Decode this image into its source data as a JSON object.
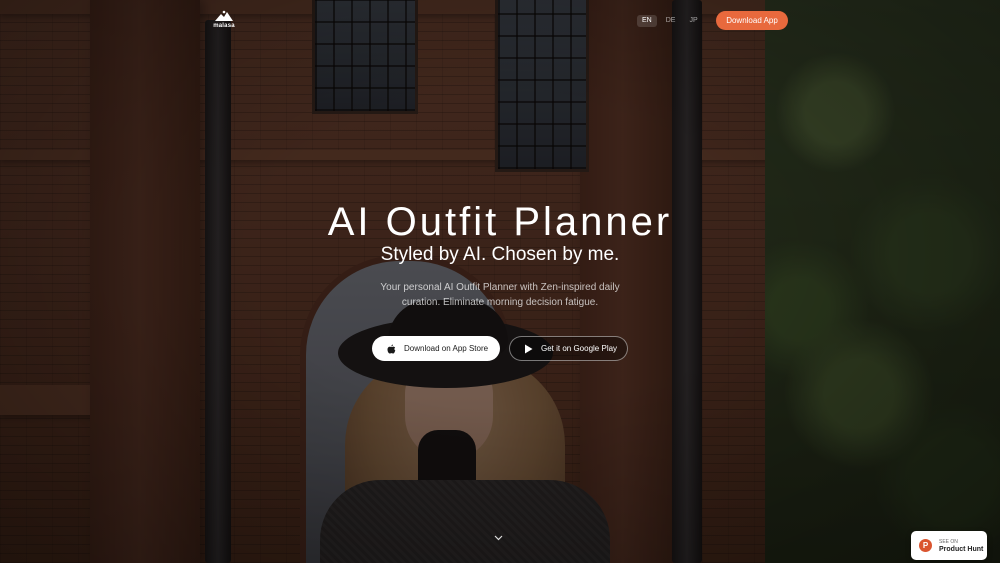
{
  "brand": {
    "name": "malasa"
  },
  "header": {
    "languages": [
      "EN",
      "DE",
      "JP"
    ],
    "active_language": "EN",
    "download_label": "Download App",
    "accent_color": "#e8693d"
  },
  "hero": {
    "title": "AI Outfit Planner",
    "subtitle": "Styled by AI. Chosen by me.",
    "description": "Your personal AI Outfit Planner with Zen-inspired daily curation. Eliminate morning decision fatigue.",
    "app_store_label": "Download on App Store",
    "google_play_label": "Get it on Google Play",
    "scroll_icon": "chevron-down-icon"
  },
  "product_hunt": {
    "small": "SEE ON",
    "big": "Product Hunt",
    "color": "#da552f"
  }
}
